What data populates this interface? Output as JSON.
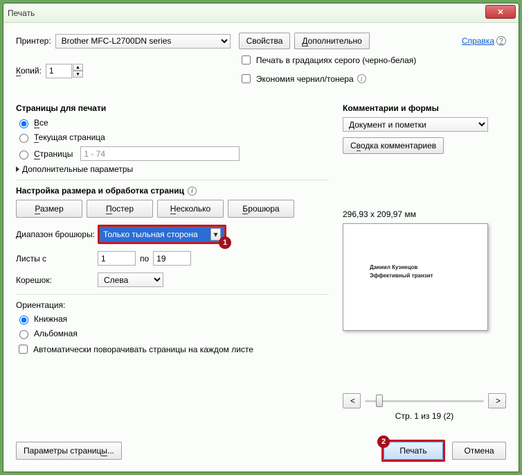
{
  "window": {
    "title": "Печать"
  },
  "top": {
    "printer_label": "Принтер:",
    "printer_value": "Brother MFC-L2700DN series",
    "properties_btn": "Свойства",
    "advanced_btn": "Дополнительно",
    "help_link": "Справка",
    "copies_label": "Копий:",
    "copies_value": "1",
    "grayscale_label": "Печать в градациях серого (черно-белая)",
    "ink_label": "Экономия чернил/тонера"
  },
  "pages": {
    "title": "Страницы для печати",
    "all": "Все",
    "all_hot": "В",
    "current": "Текущая страница",
    "current_hot": "Т",
    "range": "Страницы",
    "range_hot": "С",
    "range_value": "1 - 74",
    "more": "Дополнительные параметры"
  },
  "sizing": {
    "title": "Настройка размера и обработка страниц",
    "tab_size": "Размер",
    "tab_poster": "Постер",
    "tab_multi": "Несколько",
    "tab_booklet": "Брошюра",
    "range_label": "Диапазон брошюры:",
    "range_value": "Только тыльная сторона",
    "sheets_label": "Листы с",
    "sheets_from": "1",
    "sheets_to_label": "по",
    "sheets_to": "19",
    "spine_label": "Корешок:",
    "spine_value": "Слева"
  },
  "orient": {
    "title": "Ориентация:",
    "portrait": "Книжная",
    "landscape": "Альбомная",
    "auto": "Автоматически поворачивать страницы на каждом листе"
  },
  "comments": {
    "title": "Комментарии и формы",
    "value": "Документ и пометки",
    "summary_btn": "Сводка комментариев"
  },
  "preview": {
    "dims": "296,93 x 209,97 мм",
    "line1": "Даниил Кузнецов",
    "line2": "Эффективный транзит",
    "nav_prev": "<",
    "nav_next": ">",
    "page_ind": "Стр. 1 из 19 (2)"
  },
  "footer": {
    "page_setup": "Параметры страницы...",
    "print": "Печать",
    "cancel": "Отмена"
  },
  "badges": {
    "one": "1",
    "two": "2"
  }
}
